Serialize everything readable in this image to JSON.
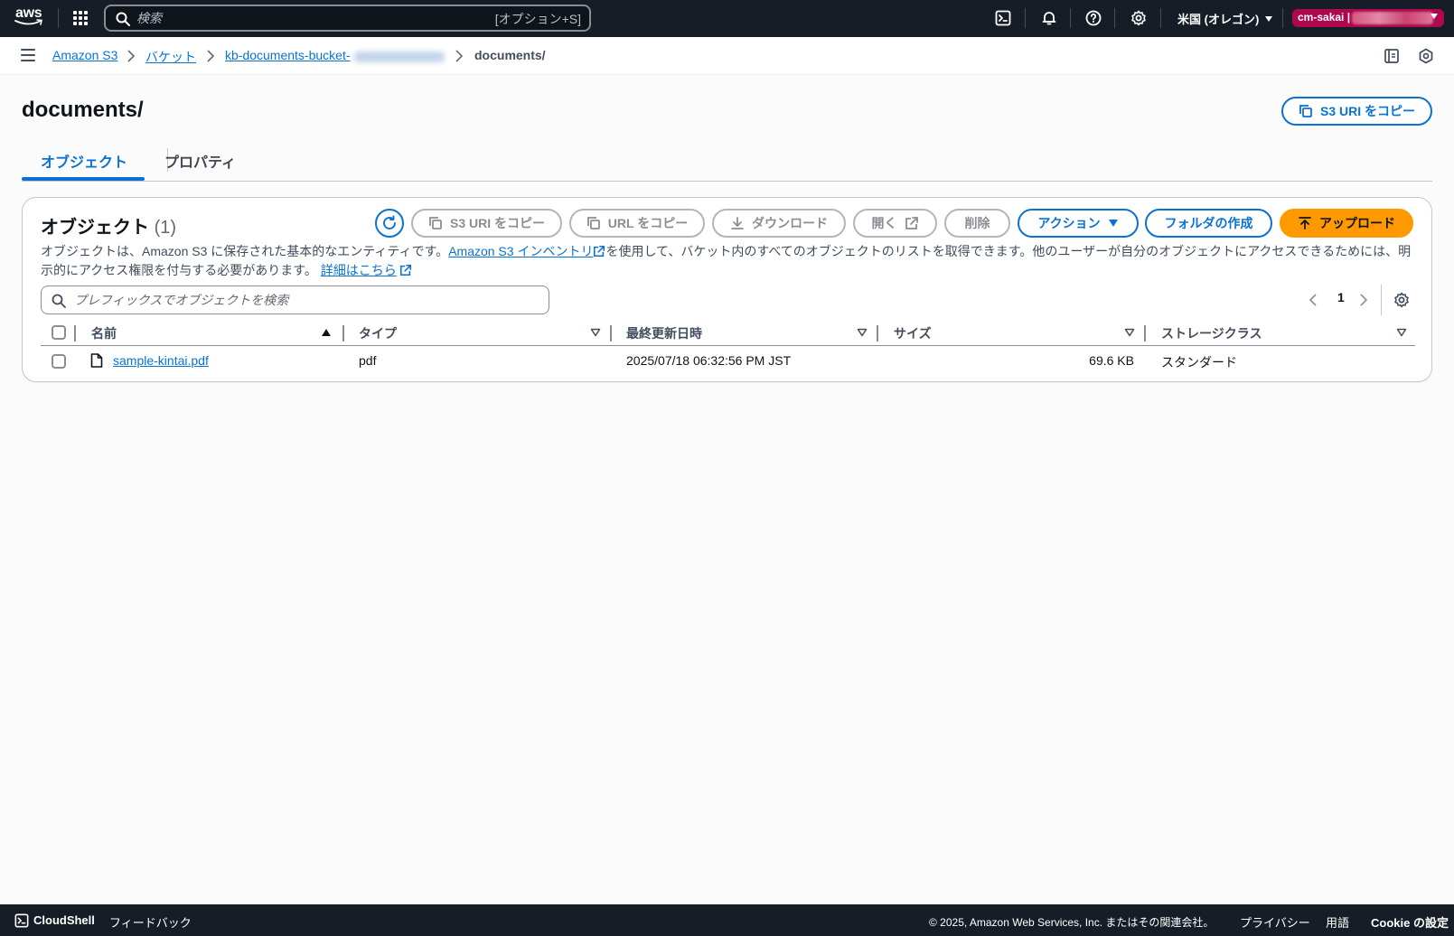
{
  "topnav": {
    "logo_text": "aws",
    "search_placeholder": "検索",
    "search_shortcut": "[オプション+S]",
    "region": "米国 (オレゴン)",
    "account": "cm-sakai |",
    "icons": [
      "cloudshell-icon",
      "bell-icon",
      "help-icon",
      "settings-icon"
    ]
  },
  "breadcrumb": {
    "items": [
      "Amazon S3",
      "バケット",
      "kb-documents-bucket-",
      "documents/"
    ]
  },
  "page": {
    "title": "documents/",
    "copy_s3_uri": "S3 URI をコピー"
  },
  "tabs": [
    {
      "label": "オブジェクト",
      "active": true
    },
    {
      "label": "プロパティ",
      "active": false
    }
  ],
  "objects_panel": {
    "title": "オブジェクト",
    "count": "(1)",
    "buttons": {
      "copy_s3_uri": "S3 URI をコピー",
      "copy_url": "URL をコピー",
      "download": "ダウンロード",
      "open": "開く",
      "delete": "削除",
      "actions": "アクション",
      "create_folder": "フォルダの作成",
      "upload": "アップロード"
    },
    "description_1": "オブジェクトは、Amazon S3 に保存された基本的なエンティティです。",
    "description_link": "Amazon S3 インベントリ",
    "description_2": "を使用して、バケット内のすべてのオブジェクトのリストを取得できます。他のユーザーが自分のオブジェクトにアクセスできるためには、明示的にアクセス権限を付与する必要があります。",
    "learn_more": "詳細はこちら",
    "filter_placeholder": "プレフィックスでオブジェクトを検索",
    "page_number": "1"
  },
  "table": {
    "columns": [
      "名前",
      "タイプ",
      "最終更新日時",
      "サイズ",
      "ストレージクラス"
    ],
    "rows": [
      {
        "name": "sample-kintai.pdf",
        "type": "pdf",
        "last_modified": "2025/07/18 06:32:56 PM JST",
        "size": "69.6 KB",
        "storage_class": "スタンダード"
      }
    ]
  },
  "footer": {
    "cloudshell": "CloudShell",
    "feedback": "フィードバック",
    "copyright": "© 2025, Amazon Web Services, Inc. またはその関連会社。",
    "privacy": "プライバシー",
    "terms": "用語",
    "cookie": "Cookie の設定"
  },
  "colors": {
    "nav_bg": "#161d26",
    "link": "#0972d3",
    "primary": "#ff9900",
    "account_badge": "#b0084d"
  }
}
